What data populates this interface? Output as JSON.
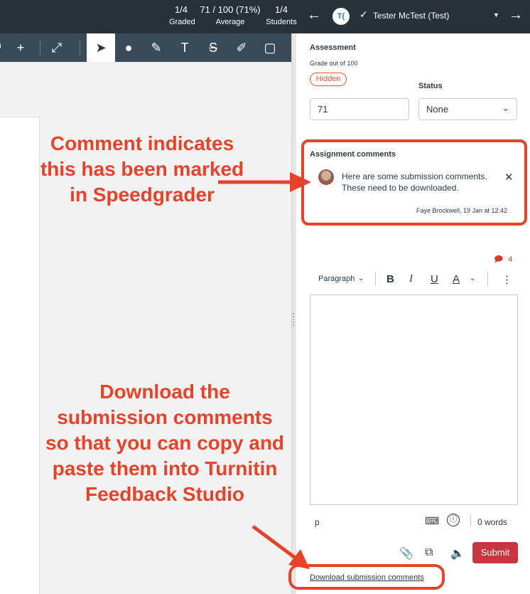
{
  "header": {
    "stats": [
      {
        "value": "1/4",
        "label": "Graded"
      },
      {
        "value": "71 / 100 (71%)",
        "label": "Average"
      },
      {
        "value": "1/4",
        "label": "Students"
      }
    ],
    "student_initials": "T(",
    "student_name": "Tester McTest (Test)",
    "prev_icon": "arrow-left-icon",
    "next_icon": "arrow-right-icon"
  },
  "toolbar": {
    "tools": [
      "zoom-icon",
      "plus-icon",
      "expand-icon",
      "pointer-icon",
      "pin-icon",
      "highlight-icon",
      "text-icon",
      "strikeout-icon",
      "draw-icon",
      "area-icon"
    ]
  },
  "assessment": {
    "heading": "Assessment",
    "grade_out_of": "Grade out of 100",
    "hidden_pill": "Hidden",
    "status_label": "Status",
    "grade_value": "71",
    "status_value": "None"
  },
  "comments": {
    "heading": "Assignment comments",
    "text": "Here are some submission comments. These need to be downloaded.",
    "meta": "Faye Brockwell, 19 Jan at 12:42",
    "close_symbol": "✕",
    "count": "4"
  },
  "editor": {
    "paragraph_label": "Paragraph",
    "bold": "B",
    "italic": "I",
    "underline": "U",
    "text_color": "A",
    "more": "⋮",
    "path": "p",
    "word_count": "0 words"
  },
  "actions": {
    "submit_label": "Submit",
    "download_link": "Download submission comments"
  },
  "annotations": {
    "top_note": "Comment indicates this has been marked in Speedgrader",
    "bottom_note": "Download the submission comments so that you can copy and paste them into Turnitin Feedback Studio"
  },
  "colors": {
    "header_bg": "#263238",
    "toolbar_bg": "#394b58",
    "annotation": "#e8432a",
    "submit_bg": "#c9353e"
  }
}
